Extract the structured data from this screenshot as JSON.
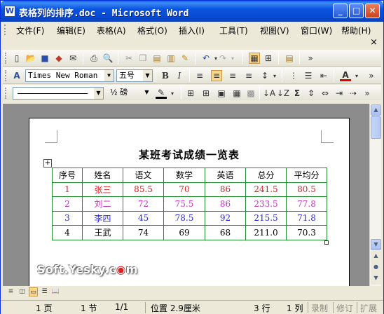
{
  "window": {
    "app_icon_label": "W",
    "title": "表格列的排序.doc - Microsoft Word",
    "minimize": "_",
    "maximize": "□",
    "close": "✕"
  },
  "menu": {
    "items": [
      "文件(F)",
      "编辑(E)",
      "表格(A)",
      "格式(O)",
      "插入(I)",
      "工具(T)",
      "视图(V)",
      "窗口(W)",
      "帮助(H)"
    ],
    "close_glyph": "×"
  },
  "formatting": {
    "font_name": "Times New Roman",
    "font_size": "五号",
    "bold": "B",
    "italic": "I",
    "font_color_label": "A"
  },
  "tables_toolbar": {
    "line_weight": "½ 磅",
    "sigma": "Σ"
  },
  "document": {
    "title": "某班考试成绩一览表",
    "table": {
      "headers": [
        "序号",
        "姓名",
        "语文",
        "数学",
        "英语",
        "总分",
        "平均分"
      ],
      "rows": [
        {
          "cells": [
            "1",
            "张三",
            "85.5",
            "70",
            "86",
            "241.5",
            "80.5"
          ],
          "color": "#dd1f1f"
        },
        {
          "cells": [
            "2",
            "刘二",
            "72",
            "75.5",
            "86",
            "233.5",
            "77.8"
          ],
          "color": "#cc33cc"
        },
        {
          "cells": [
            "3",
            "李四",
            "45",
            "78.5",
            "92",
            "215.5",
            "71.8"
          ],
          "color": "#2b2bdd"
        },
        {
          "cells": [
            "4",
            "王武",
            "74",
            "69",
            "68",
            "211.0",
            "70.3"
          ],
          "color": "#000000"
        }
      ]
    }
  },
  "watermark": {
    "text_before": "Soft.Yesky.c",
    "dot": "◉",
    "text_after": "m"
  },
  "status": {
    "page": "1 页",
    "section": "1 节",
    "page_of": "1/1",
    "position": "位置 2.9厘米",
    "line": "3 行",
    "column": "1 列",
    "rec": "录制",
    "trk": "修订",
    "ext": "扩展"
  },
  "colors": {
    "title_bar": "#0a54e0",
    "table_border": "#1e8f2c",
    "highlight": "#f7d58e"
  }
}
